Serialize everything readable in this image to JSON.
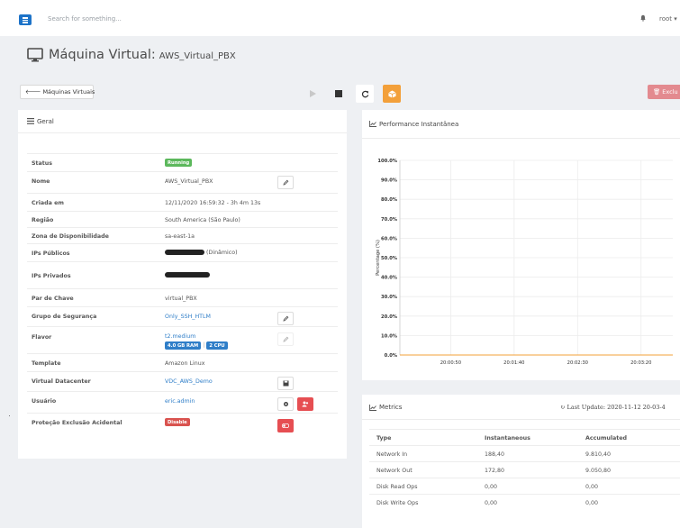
{
  "topbar": {
    "search_placeholder": "Search for something...",
    "user": "root"
  },
  "page": {
    "title": "Máquina Virtual:",
    "vm_name": "AWS_Virtual_PBX"
  },
  "toolbar": {
    "back_label": "Máquinas Virtuais",
    "delete_label": "Exclu"
  },
  "geral": {
    "title": "Geral",
    "rows": [
      {
        "label": "Status",
        "value": "Running"
      },
      {
        "label": "Nome",
        "value": "AWS_Virtual_PBX"
      },
      {
        "label": "Criada em",
        "value": "12/11/2020 16:59:32 - 3h 4m 13s"
      },
      {
        "label": "Região",
        "value": "South America (São Paulo)"
      },
      {
        "label": "Zona de Disponibilidade",
        "value": "sa-east-1a"
      },
      {
        "label": "IPs Públicos",
        "value": "(Dinâmico)"
      },
      {
        "label": "IPs Privados",
        "value": ""
      },
      {
        "label": "Par de Chave",
        "value": "virtual_PBX"
      },
      {
        "label": "Grupo de Segurança",
        "value": "Only_SSH_HTLM"
      },
      {
        "label": "Flavor",
        "value": "t2.medium",
        "ram": "4.0 GB RAM",
        "cpu": "2 CPU"
      },
      {
        "label": "Template",
        "value": "Amazon Linux"
      },
      {
        "label": "Virtual Datacenter",
        "value": "VDC_AWS_Demo"
      },
      {
        "label": "Usuário",
        "value": "eric.admin"
      },
      {
        "label": "Proteção Exclusão Acidental",
        "value": "Disable"
      }
    ]
  },
  "performance": {
    "title": "Performance Instantânea",
    "y_label": "Percentage (%)",
    "y_ticks": [
      "100.0%",
      "90.0%",
      "80.0%",
      "70.0%",
      "60.0%",
      "50.0%",
      "40.0%",
      "30.0%",
      "20.0%",
      "10.0%",
      "0.0%"
    ],
    "x_ticks": [
      "20:00:50",
      "20:01:40",
      "20:02:30",
      "20:03:20"
    ],
    "line_color": "#f3a03a",
    "series_value": 0
  },
  "metrics": {
    "title": "Metrics",
    "last_update": "Last Update: 2020-11-12 20-03-4",
    "headers": [
      "Type",
      "Instantaneous",
      "Accumulated"
    ],
    "rows": [
      [
        "Network In",
        "188,40",
        "9.810,40"
      ],
      [
        "Network Out",
        "172,80",
        "9.050,80"
      ],
      [
        "Disk Read Ops",
        "0,00",
        "0,00"
      ],
      [
        "Disk Write Ops",
        "0,00",
        "0,00"
      ]
    ]
  },
  "colors": {
    "accent_blue": "#1d73c8",
    "orange": "#f3a03a",
    "green": "#5cb85c",
    "red": "#e64e52"
  }
}
